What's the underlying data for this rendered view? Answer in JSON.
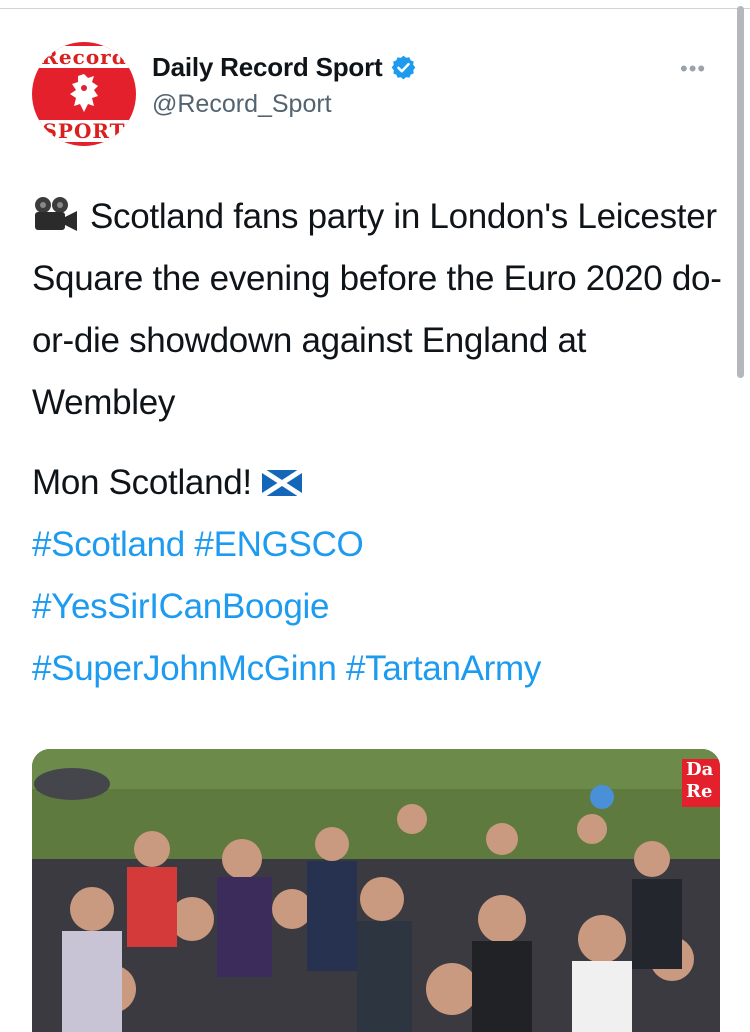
{
  "author": {
    "display_name": "Daily Record Sport",
    "handle": "@Record_Sport",
    "verified": true,
    "avatar": {
      "top_text": "Record",
      "bottom_text": "SPORT"
    }
  },
  "menu": {
    "more_label": "•••"
  },
  "tweet": {
    "line1": "Scotland fans party in London's Leicester Square the evening before the Euro 2020 do-or-die showdown against England at Wembley",
    "line2": "Mon Scotland!",
    "hashtags": [
      "#Scotland",
      "#ENGSCO",
      "#YesSirICanBoogie",
      "#SuperJohnMcGinn",
      "#TartanArmy"
    ],
    "icons": {
      "leading": "movie-camera-icon",
      "trailing": "scotland-flag-icon"
    }
  },
  "media": {
    "brand_text": "Da Re",
    "description_hidden": false
  },
  "colors": {
    "hashtag": "#1d9bf0",
    "verified": "#1d9bf0",
    "brand_red": "#e3202b"
  }
}
